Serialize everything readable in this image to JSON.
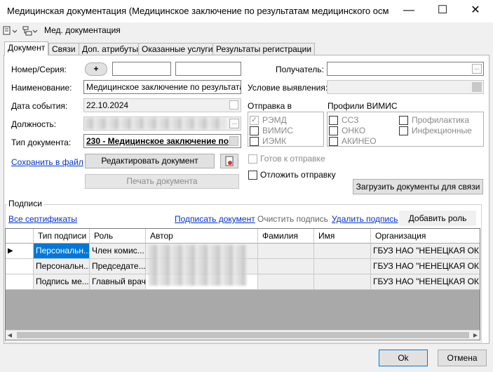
{
  "window": {
    "title": "Медицинская документация (Медицинское заключение по результатам медицинского осмотра р...",
    "minimize": "—",
    "maximize": "☐",
    "close": "✕"
  },
  "toolbar": {
    "icon1": "doc-menu-icon",
    "icon2": "tree-menu-icon",
    "label": "Мед. документация"
  },
  "tabs": [
    "Документ",
    "Связи",
    "Доп. атрибуты",
    "Оказанные услуги",
    "Результаты регистрации"
  ],
  "form": {
    "number_label": "Номер/Серия:",
    "number_btn": "+",
    "name_label": "Наименование:",
    "name_value": "Медицинское заключение по результатам",
    "date_label": "Дата события:",
    "date_value": "22.10.2024",
    "position_label": "Должность:",
    "doctype_label": "Тип документа:",
    "doctype_value": "230 - Медицинское заключение по",
    "save_link": "Сохранить в файл",
    "edit_btn": "Редактировать документ",
    "print_btn": "Печать документа",
    "recipient_label": "Получатель:",
    "condition_label": "Условие выявления:",
    "send_to_label": "Отправка в",
    "send_to": [
      "РЭМД",
      "ВИМИС",
      "ИЭМК"
    ],
    "send_to_checked": [
      true,
      false,
      false
    ],
    "profiles_label": "Профили ВИМИС",
    "profiles_col1": [
      "ССЗ",
      "ОНКО",
      "АКИНЕО"
    ],
    "profiles_col2": [
      "Профилактика",
      "Инфекционные"
    ],
    "ready_label": "Готов к отправке",
    "postpone_label": "Отложить отправку",
    "load_btn": "Загрузить документы для связи"
  },
  "signatures": {
    "group_label": "Подписи",
    "all_certs": "Все сертификаты",
    "sign_doc": "Подписать документ",
    "clear_sign": "Очистить подпись",
    "delete_sign": "Удалить подпись",
    "add_role": "Добавить роль",
    "columns": [
      "Тип подписи",
      "Роль",
      "Автор",
      "Фамилия",
      "Имя",
      "Организация"
    ],
    "rows": [
      {
        "type": "Персональн...",
        "role": "Член комис...",
        "org": "ГБУЗ НАО \"НЕНЕЦКАЯ ОК..."
      },
      {
        "type": "Персональн...",
        "role": "Председате...",
        "org": "ГБУЗ НАО \"НЕНЕЦКАЯ ОК..."
      },
      {
        "type": "Подпись ме...",
        "role": "Главный врач",
        "org": "ГБУЗ НАО \"НЕНЕЦКАЯ ОК..."
      }
    ],
    "row_marker": "▶"
  },
  "buttons": {
    "ok": "Ok",
    "cancel": "Отмена"
  }
}
